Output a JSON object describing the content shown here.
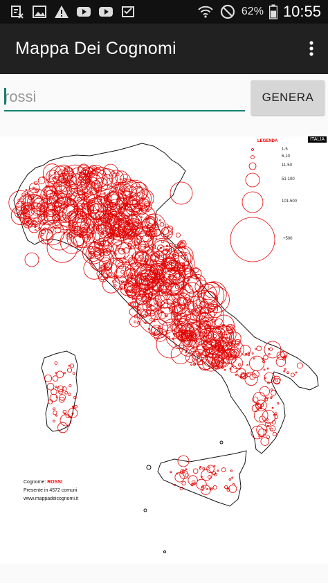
{
  "status_bar": {
    "battery": "62%",
    "time": "10:55",
    "icons": [
      "sim-manager-icon",
      "image-icon",
      "warning-icon",
      "youtube-icon",
      "youtube-icon",
      "inbox-check-icon",
      "wifi-icon",
      "do-not-disturb-icon",
      "battery-icon"
    ]
  },
  "app_bar": {
    "title": "Mappa Dei Cognomi",
    "menu_icon": "more-vert-icon"
  },
  "search": {
    "value": "rossi",
    "button_label": "GENERA"
  },
  "map": {
    "corner_tag": "ITALIA",
    "legend": {
      "title": "LEGENDA",
      "items": [
        "1-5",
        "6-10",
        "11-50",
        "51-100",
        "101-500",
        "+500"
      ]
    },
    "info": {
      "surname_label": "Cognome:",
      "surname_value": "ROSSI",
      "presence": "Presente in 4572 comuni",
      "site": "www.mappadeicognomi.it"
    },
    "colors": {
      "marker": "#e00000",
      "outline": "#111111"
    }
  }
}
